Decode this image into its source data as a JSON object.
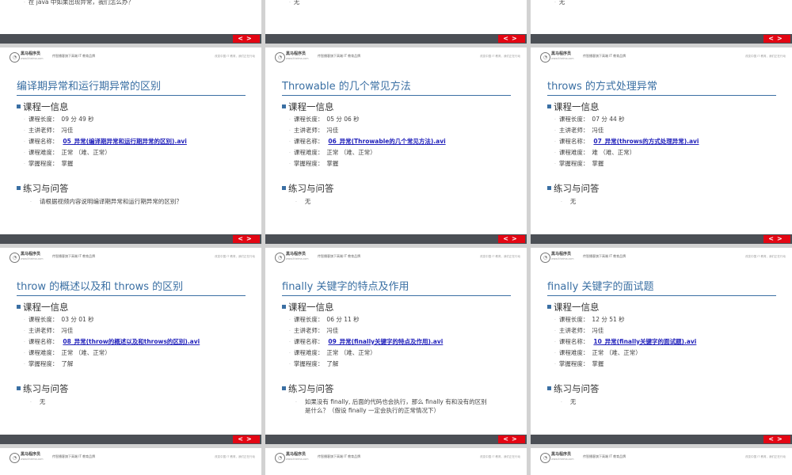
{
  "header": {
    "logo_text": "黑马程序员",
    "logo_url": "www.itheima.com",
    "slogan": "传智播客旗下高端 IT 教育品牌",
    "tagline": "改变中国 IT 教育，我们正在行动"
  },
  "labels": {
    "course_info": "课程一信息",
    "qa": "练习与问答",
    "length": "课程长度：",
    "teacher": "主讲老师：",
    "name": "课程名称：",
    "difficulty": "课程难度：",
    "mastery": "掌握程度："
  },
  "nav": {
    "prev": "<",
    "next": ">"
  },
  "top_row": [
    {
      "qa": "在 java 中如果出现异常，我们怎么办？"
    },
    {
      "qa": "无"
    },
    {
      "qa": "无"
    }
  ],
  "slides": [
    {
      "title": "编译期异常和运行期异常的区别",
      "length": "09 分 49 秒",
      "teacher": "冯佳",
      "name": "05_异常(编译期异常和运行期异常的区别).avi",
      "difficulty": "正常 （难、正常）",
      "mastery": "掌握",
      "qa1": "请根据视频内容说明编译期异常和运行期异常的区别？",
      "qa2": ""
    },
    {
      "title": "Throwable 的几个常见方法",
      "length": "05 分 06 秒",
      "teacher": "冯佳",
      "name": "06_异常(Throwable的几个常见方法).avi",
      "difficulty": "正常 （难、正常）",
      "mastery": "掌握",
      "qa1": "无",
      "qa2": ""
    },
    {
      "title": "throws 的方式处理异常",
      "length": "07 分 44 秒",
      "teacher": "冯佳",
      "name": "07_异常(throws的方式处理异常).avi",
      "difficulty": "难 （难、正常）",
      "mastery": "掌握",
      "qa1": "无",
      "qa2": ""
    },
    {
      "title": "throw 的概述以及和 throws 的区别",
      "length": "03 分 01 秒",
      "teacher": "冯佳",
      "name": "08_异常(throw的概述以及和throws的区别).avi",
      "difficulty": "正常 （难、正常）",
      "mastery": "了解",
      "qa1": "无",
      "qa2": ""
    },
    {
      "title": "finally 关键字的特点及作用",
      "length": "06 分 11 秒",
      "teacher": "冯佳",
      "name": "09_异常(finally关键字的特点及作用).avi",
      "difficulty": "正常 （难、正常）",
      "mastery": "了解",
      "qa1": "如果没有 finally, 后面的代码也会执行，那么 finally 有和没有的区别",
      "qa2": "是什么？（假设 finally 一定会执行的正常情况下）"
    },
    {
      "title": "finally 关键字的面试题",
      "length": "12 分 51 秒",
      "teacher": "冯佳",
      "name": "10_异常(finally关键字的面试题).avi",
      "difficulty": "正常 （难、正常）",
      "mastery": "掌握",
      "qa1": "无",
      "qa2": ""
    }
  ]
}
